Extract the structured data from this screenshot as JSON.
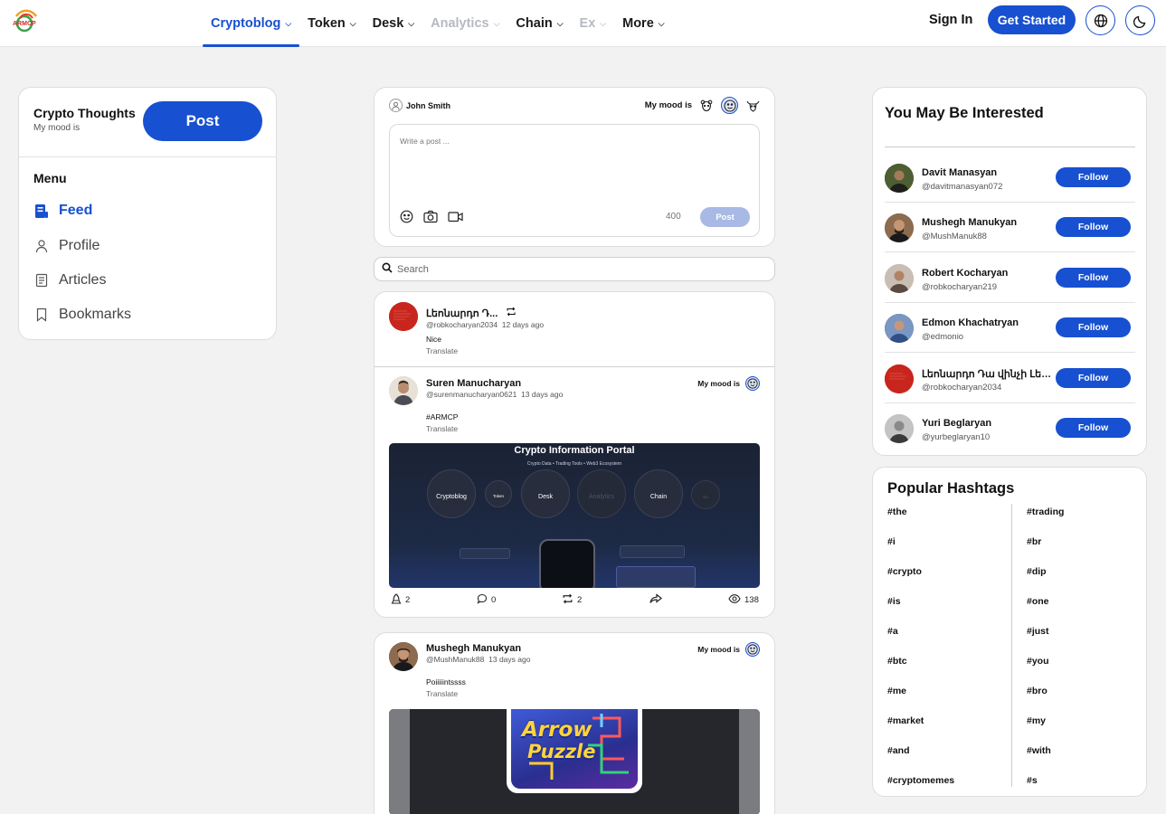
{
  "header": {
    "logo_text": "ARMCP",
    "nav": [
      {
        "label": "Cryptoblog",
        "state": "active"
      },
      {
        "label": "Token",
        "state": "normal"
      },
      {
        "label": "Desk",
        "state": "normal"
      },
      {
        "label": "Analytics",
        "state": "disabled"
      },
      {
        "label": "Chain",
        "state": "normal"
      },
      {
        "label": "Ex",
        "state": "disabled"
      },
      {
        "label": "More",
        "state": "normal"
      }
    ],
    "sign_in": "Sign In",
    "get_started": "Get Started",
    "icons": [
      "globe-icon",
      "moon-icon"
    ]
  },
  "colors": {
    "accent": "#1750d0",
    "background": "#f2f2f3",
    "disabled_text": "#b6b9c2"
  },
  "left": {
    "title": "Crypto Thoughts",
    "subtitle": "My mood is",
    "post_button": "Post",
    "menu_heading": "Menu",
    "menu": [
      {
        "label": "Feed",
        "icon": "feed-icon",
        "active": true
      },
      {
        "label": "Profile",
        "icon": "user-icon",
        "active": false
      },
      {
        "label": "Articles",
        "icon": "article-icon",
        "active": false
      },
      {
        "label": "Bookmarks",
        "icon": "bookmark-icon",
        "active": false
      }
    ]
  },
  "composer": {
    "user": "John Smith",
    "mood_label": "My mood is",
    "mood_icons": [
      "bear-icon",
      "neutral-face-icon",
      "bull-icon"
    ],
    "selected_mood": "neutral-face-icon",
    "placeholder": "Write a post ...",
    "char_count": "400",
    "post_button": "Post"
  },
  "search": {
    "placeholder": "Search"
  },
  "feed": {
    "repost": {
      "name": "Լեոնարդո Դ...",
      "handle": "@robkocharyan2034",
      "time": "12 days ago",
      "text": "Nice",
      "translate": "Translate"
    },
    "post1": {
      "name": "Suren Manucharyan",
      "handle": "@surenmanucharyan0621",
      "time": "13 days ago",
      "mood_label": "My mood is",
      "text": "#ARMCP",
      "translate": "Translate",
      "image": {
        "title": "Crypto Information Portal",
        "subtitle": "Crypto Data • Trading Tools • Web3 Ecosystem",
        "circles": [
          "Cryptoblog",
          "Token",
          "Desk",
          "Analytics",
          "Chain",
          "Ex"
        ]
      },
      "stats": {
        "likes": "2",
        "comments": "0",
        "reposts": "2",
        "views": "138"
      }
    },
    "post2": {
      "name": "Mushegh Manukyan",
      "handle": "@MushManuk88",
      "time": "13 days ago",
      "mood_label": "My mood is",
      "text": "Poiiiiintssss",
      "translate": "Translate",
      "image": {
        "title_line1": "Arrow",
        "title_line2": "Puzzle"
      }
    }
  },
  "interested": {
    "title": "You May Be Interested",
    "follow_label": "Follow",
    "people": [
      {
        "name": "Davit Manasyan",
        "handle": "@davitmanasyan072"
      },
      {
        "name": "Mushegh Manukyan",
        "handle": "@MushManuk88"
      },
      {
        "name": "Robert Kocharyan",
        "handle": "@robkocharyan219"
      },
      {
        "name": "Edmon Khachatryan",
        "handle": "@edmonio"
      },
      {
        "name": "Լեոնարդո Դա վինչի Լեո...",
        "handle": "@robkocharyan2034"
      },
      {
        "name": "Yuri Beglaryan",
        "handle": "@yurbeglaryan10"
      }
    ]
  },
  "hashtags": {
    "title": "Popular Hashtags",
    "col1": [
      "#the",
      "#i",
      "#crypto",
      "#is",
      "#a",
      "#btc",
      "#me",
      "#market",
      "#and",
      "#cryptomemes"
    ],
    "col2": [
      "#trading",
      "#br",
      "#dip",
      "#one",
      "#just",
      "#you",
      "#bro",
      "#my",
      "#with",
      "#s"
    ]
  }
}
